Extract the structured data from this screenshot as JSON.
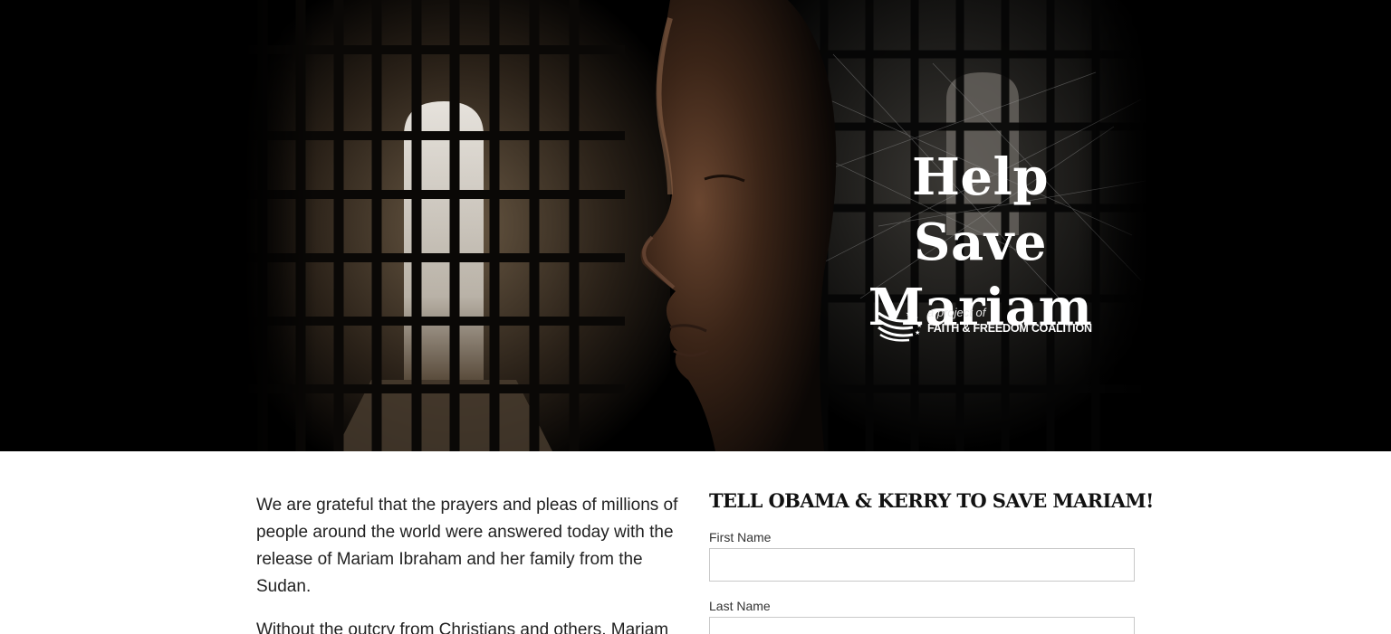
{
  "hero": {
    "title_line1": "Help Save",
    "title_line2": "Mariam",
    "logo_tagline": "a project of",
    "logo_org": "FAITH & FREEDOM COALITION"
  },
  "content": {
    "paragraphs": [
      "We are grateful that the prayers and pleas of millions of people around the world were answered today with the release of Mariam Ibraham and her family from the Sudan.",
      "Without the outcry from Christians and others, Mariam"
    ]
  },
  "form": {
    "heading": "TELL OBAMA & KERRY TO SAVE MARIAM!",
    "first_name_label": "First Name",
    "first_name_value": "",
    "last_name_label": "Last Name",
    "last_name_value": ""
  },
  "colors": {
    "hero_background": "#000000",
    "page_background": "#ffffff",
    "text": "#222222"
  }
}
